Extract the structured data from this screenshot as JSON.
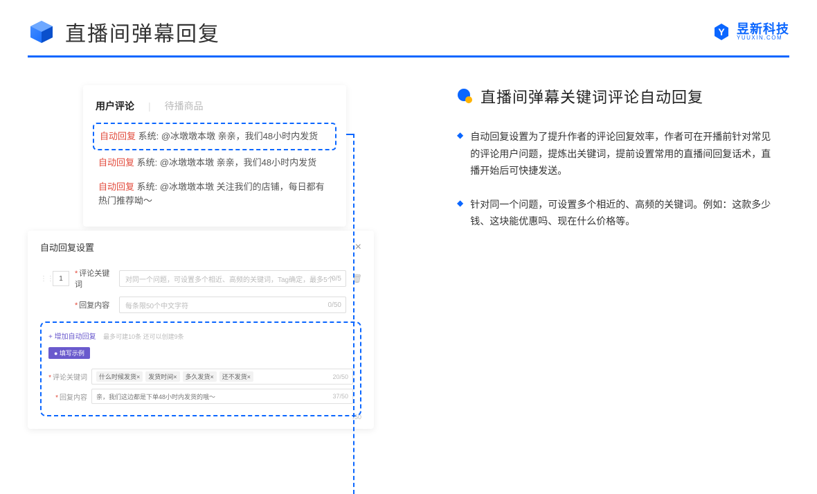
{
  "header": {
    "title": "直播间弹幕回复",
    "logo_cn": "昱新科技",
    "logo_en": "YUUXIN.COM"
  },
  "comments": {
    "tab_active": "用户评论",
    "tab_inactive": "待播商品",
    "auto_label": "自动回复",
    "items": [
      {
        "sys": "系统: @冰墩墩本墩 亲亲，我们48小时内发货"
      },
      {
        "sys": "系统: @冰墩墩本墩 亲亲，我们48小时内发货"
      },
      {
        "sys": "系统: @冰墩墩本墩 关注我们的店铺，每日都有热门推荐呦～"
      }
    ]
  },
  "settings": {
    "title": "自动回复设置",
    "num": "1",
    "keyword_label": "评论关键词",
    "keyword_placeholder": "对同一个问题，可设置多个相近、高频的关键词，Tag确定，最多5个",
    "keyword_counter": "0/5",
    "content_label": "回复内容",
    "content_placeholder": "每条限50个中文字符",
    "content_counter": "0/50",
    "add_link": "+ 增加自动回复",
    "add_hint": "最多可建10条 还可以创建9条",
    "example_badge": "● 填写示例",
    "ex_keyword_label": "评论关键词",
    "ex_tags": [
      "什么时候发货×",
      "发货时间×",
      "多久发货×",
      "还不发货×"
    ],
    "ex_keyword_counter": "20/50",
    "ex_content_label": "回复内容",
    "ex_content_text": "亲，我们这边都是下单48小时内发货的哦～",
    "ex_content_counter": "37/50",
    "extra_counter": "/50"
  },
  "right": {
    "section_title": "直播间弹幕关键词评论自动回复",
    "bullets": [
      "自动回复设置为了提升作者的评论回复效率，作者可在开播前针对常见的评论用户问题，提炼出关键词，提前设置常用的直播间回复话术，直播开始后可快捷发送。",
      "针对同一个问题，可设置多个相近的、高频的关键词。例如：这款多少钱、这块能优惠吗、现在什么价格等。"
    ]
  }
}
